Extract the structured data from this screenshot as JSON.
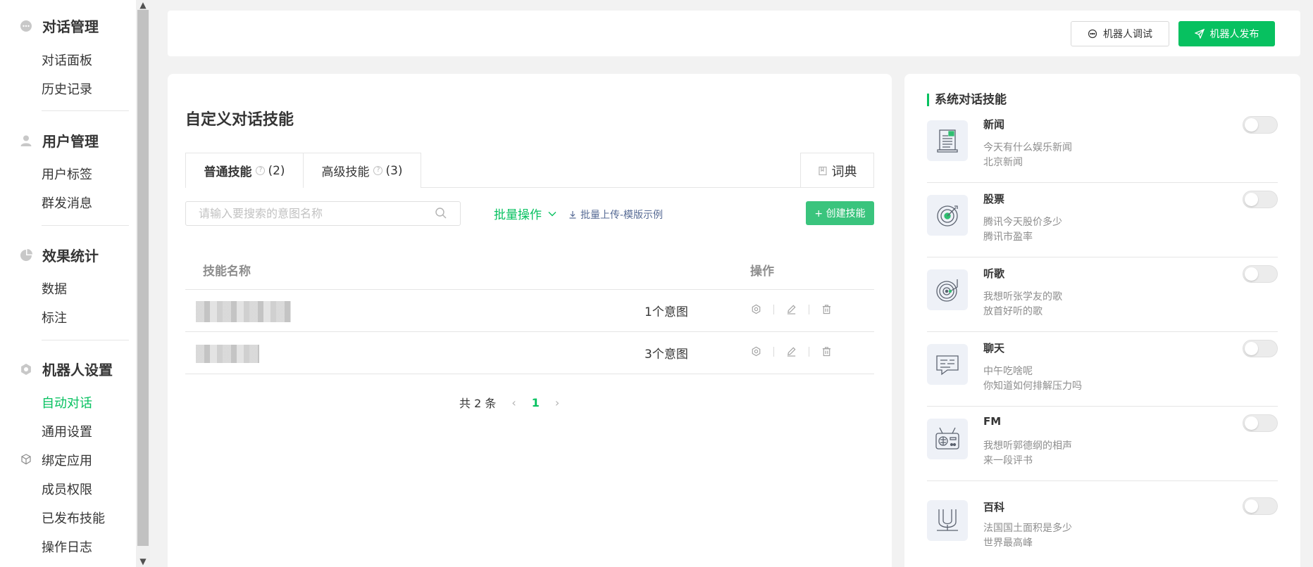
{
  "sidebar": {
    "groups": [
      {
        "title": "对话管理",
        "icon": "chat-bubble-icon",
        "items": [
          "对话面板",
          "历史记录"
        ]
      },
      {
        "title": "用户管理",
        "icon": "user-icon",
        "items": [
          "用户标签",
          "群发消息"
        ]
      },
      {
        "title": "效果统计",
        "icon": "pie-chart-icon",
        "items": [
          "数据",
          "标注"
        ]
      },
      {
        "title": "机器人设置",
        "icon": "gear-icon",
        "items": [
          "自动对话",
          "通用设置",
          "绑定应用",
          "成员权限",
          "已发布技能",
          "操作日志"
        ]
      }
    ],
    "active_item": "自动对话"
  },
  "topbar": {
    "debug_label": "机器人调试",
    "publish_label": "机器人发布"
  },
  "main": {
    "title": "自定义对话技能",
    "tabs": [
      {
        "label": "普通技能",
        "count": "(2)"
      },
      {
        "label": "高级技能",
        "count": "(3)"
      }
    ],
    "dict_label": "词典",
    "search_placeholder": "请输入要搜索的意图名称",
    "batch_op_label": "批量操作",
    "batch_upload_label": "批量上传-模版示例",
    "create_label": "+ 创建技能",
    "table": {
      "col_name": "技能名称",
      "col_op": "操作",
      "rows": [
        {
          "intents": "1个意图"
        },
        {
          "intents": "3个意图"
        }
      ]
    },
    "pager": {
      "total": "共 2 条",
      "current": "1"
    }
  },
  "right": {
    "title": "系统对话技能",
    "skills": [
      {
        "name": "新闻",
        "icon": "news-icon",
        "ex1": "今天有什么娱乐新闻",
        "ex2": "北京新闻"
      },
      {
        "name": "股票",
        "icon": "target-icon",
        "ex1": "腾讯今天股价多少",
        "ex2": "腾讯市盈率"
      },
      {
        "name": "听歌",
        "icon": "vinyl-record-icon",
        "ex1": "我想听张学友的歌",
        "ex2": "放首好听的歌"
      },
      {
        "name": "聊天",
        "icon": "chat-icon",
        "ex1": "中午吃啥呢",
        "ex2": "你知道如何排解压力吗"
      },
      {
        "name": "FM",
        "icon": "radio-icon",
        "ex1": "我想听郭德纲的相声",
        "ex2": "来一段评书"
      },
      {
        "name": "百科",
        "icon": "encyclopedia-icon",
        "ex1": "法国国土面积是多少",
        "ex2": "世界最高峰"
      }
    ]
  }
}
